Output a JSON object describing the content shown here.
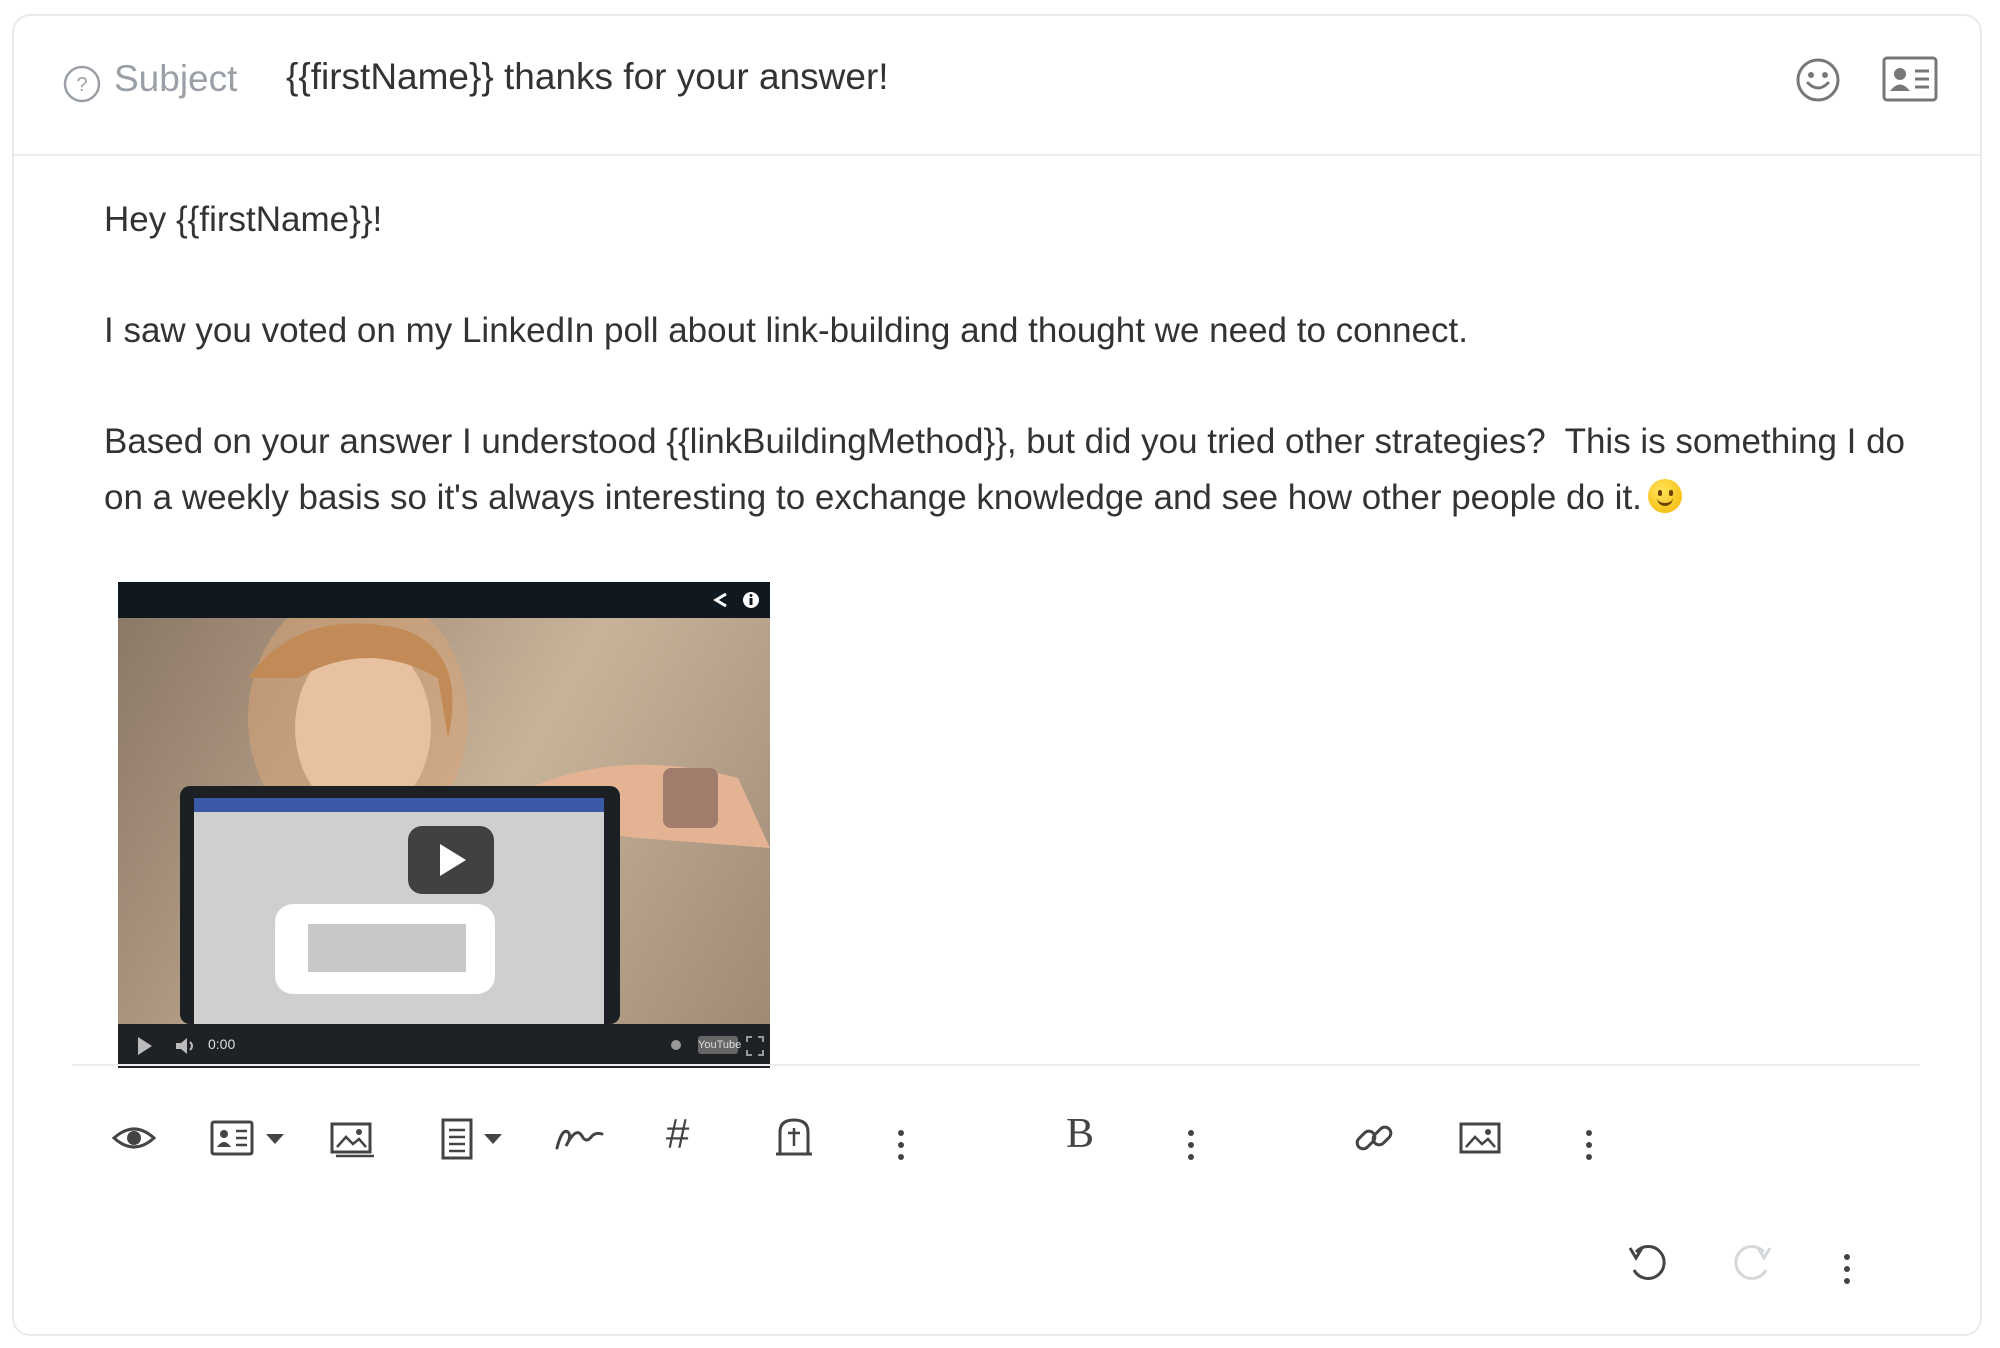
{
  "subject": {
    "label": "Subject",
    "value": "{{firstName}} thanks for your answer!"
  },
  "body": {
    "greeting": "Hey {{firstName}}!",
    "paragraph_2": "I saw you voted on my LinkedIn poll about link-building and thought we need to connect.",
    "paragraph_3": "Based on your answer I understood {{linkBuildingMethod}}, but did you tried other strategies?  This is something I do on a weekly basis so it's always interesting to exchange knowledge and see how other people do it.",
    "emoji": "slightly-smiling-face"
  },
  "video": {
    "time": "0:00",
    "provider": "YouTube"
  },
  "toolbar": {
    "bold_label": "B",
    "hash_label": "#"
  },
  "icons": [
    "help-icon",
    "emoji-icon",
    "contact-card-icon",
    "eye-icon",
    "contact-card-icon",
    "image-icon",
    "template-icon",
    "signature-icon",
    "tombstone-icon",
    "link-icon",
    "undo-icon",
    "redo-icon",
    "more-vertical-icon"
  ],
  "colors": {
    "text": "#333333",
    "muted": "#9aa0a6",
    "border": "#ebedf0",
    "icon": "#444444",
    "icon_disabled": "#d5d8db"
  }
}
